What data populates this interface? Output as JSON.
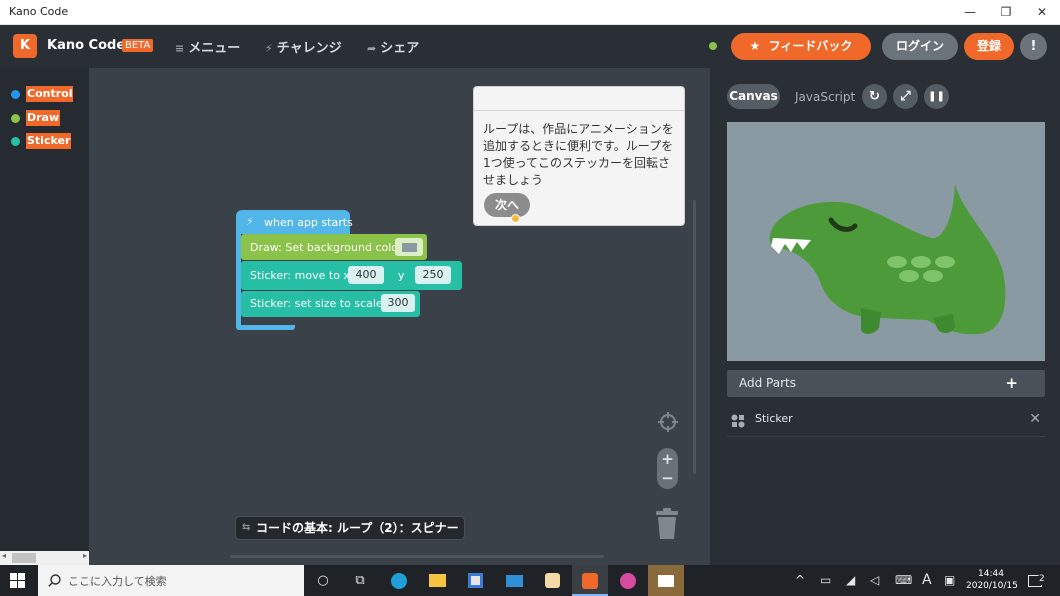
{
  "window": {
    "title": "Kano Code",
    "minimize_glyph": "—",
    "restore_glyph": "❐",
    "close_glyph": "✕"
  },
  "header": {
    "logo_letter": "K",
    "brand": "Kano Code",
    "beta": "BETA",
    "nav": [
      {
        "icon": "menu-icon",
        "glyph": "≡",
        "label": "メニュー"
      },
      {
        "icon": "bolt-icon",
        "glyph": "⚡",
        "label": "チャレンジ"
      },
      {
        "icon": "share-icon",
        "glyph": "➦",
        "label": "シェア"
      }
    ],
    "status_color": "#8bc34a",
    "feedback_label": "フィードバック",
    "feedback_glyph": "★",
    "login_label": "ログイン",
    "register_label": "登録",
    "alert_glyph": "!"
  },
  "sidebar": {
    "categories": [
      {
        "label": "Control",
        "color": "#2196f3"
      },
      {
        "label": "Draw",
        "color": "#8bc34a"
      },
      {
        "label": "Sticker",
        "color": "#26bfa6"
      }
    ]
  },
  "workspace": {
    "blocks": {
      "event": {
        "glyph": "⚡",
        "label": "when app starts",
        "color": "#52b7e8"
      },
      "draw": {
        "label": "Draw: Set background color",
        "color": "#8bc34a",
        "swatch": "#8a9aa3"
      },
      "move": {
        "label": "Sticker: move to x",
        "x": "400",
        "y_label": "y",
        "y": "250",
        "color": "#26bfa6"
      },
      "size": {
        "label": "Sticker: set size to scale",
        "scale": "300",
        "color": "#26bfa6"
      }
    },
    "tooltip": {
      "text": "ループは、作品にアニメーションを追加するときに便利です。ループを1つ使ってこのステッカーを回転させましょう",
      "next_label": "次へ"
    },
    "zoom_in": "+",
    "zoom_out": "−",
    "challenge_icon": "⇆",
    "challenge_title": "コードの基本: ループ（2）：スピナー"
  },
  "preview": {
    "tabs": {
      "canvas": "Canvas",
      "javascript": "JavaScript"
    },
    "buttons": {
      "restart": "↻",
      "fullscreen": "⤢",
      "pause": "❚❚"
    },
    "stage_bg": "#8a9aa3",
    "add_parts": "Add Parts",
    "add_glyph": "+",
    "parts": [
      {
        "label": "Sticker",
        "remove_glyph": "✕"
      }
    ]
  },
  "taskbar": {
    "search_placeholder": "ここに入力して検索",
    "ime_indicator": "A",
    "time": "14:44",
    "date": "2020/10/15",
    "notifications_count": "2"
  }
}
